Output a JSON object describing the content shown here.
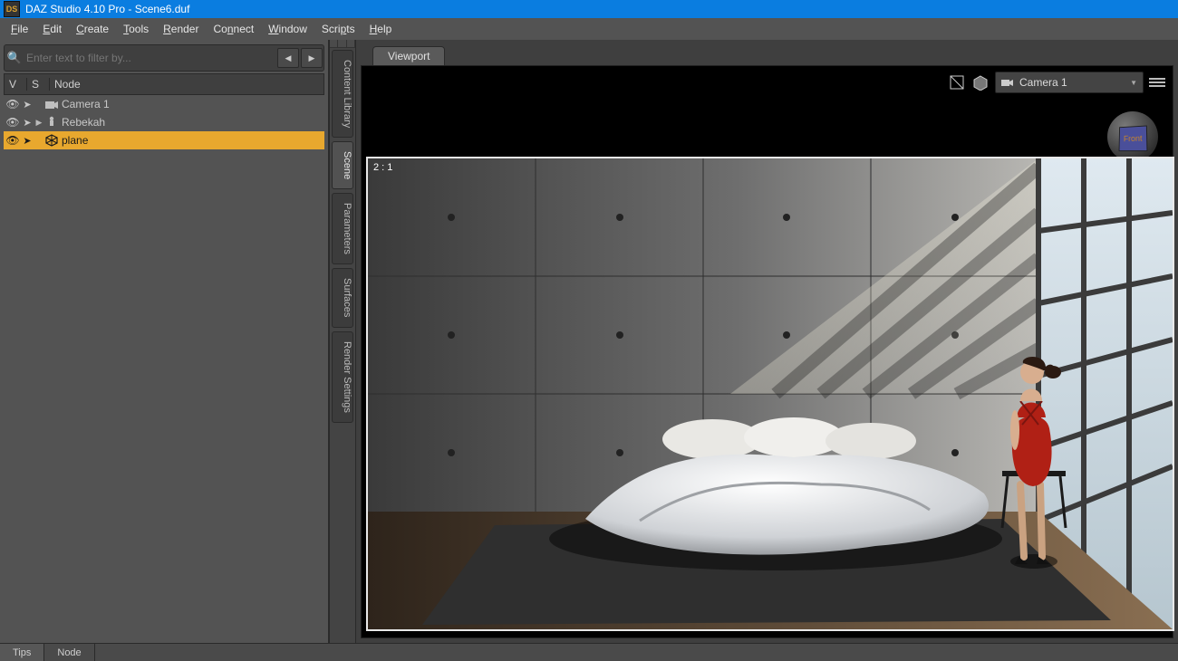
{
  "title": "DAZ Studio 4.10 Pro - Scene6.duf",
  "logo_text": "DS",
  "menu": [
    "File",
    "Edit",
    "Create",
    "Tools",
    "Render",
    "Connect",
    "Window",
    "Scripts",
    "Help"
  ],
  "filter": {
    "placeholder": "Enter text to filter by..."
  },
  "tree_header": {
    "v": "V",
    "s": "S",
    "node": "Node"
  },
  "tree": [
    {
      "name": "Camera 1",
      "icon": "camera",
      "expandable": false,
      "selected": false
    },
    {
      "name": "Rebekah",
      "icon": "figure",
      "expandable": true,
      "selected": false
    },
    {
      "name": "plane",
      "icon": "prop",
      "expandable": false,
      "selected": true
    }
  ],
  "side_tabs": [
    "Content Library",
    "Scene",
    "Parameters",
    "Surfaces",
    "Render Settings"
  ],
  "side_tab_active": 1,
  "viewport": {
    "tab_label": "Viewport",
    "camera_dd": "Camera 1",
    "navcube_face": "Front",
    "ratio": "2 : 1"
  },
  "bottom_tabs": [
    "Tips",
    "Node"
  ],
  "bottom_tab_active": 0,
  "colors": {
    "title_bg": "#0a7de0",
    "selection": "#e8a82e",
    "bg_mid": "#535353",
    "bg_dark": "#3f3f3f"
  }
}
